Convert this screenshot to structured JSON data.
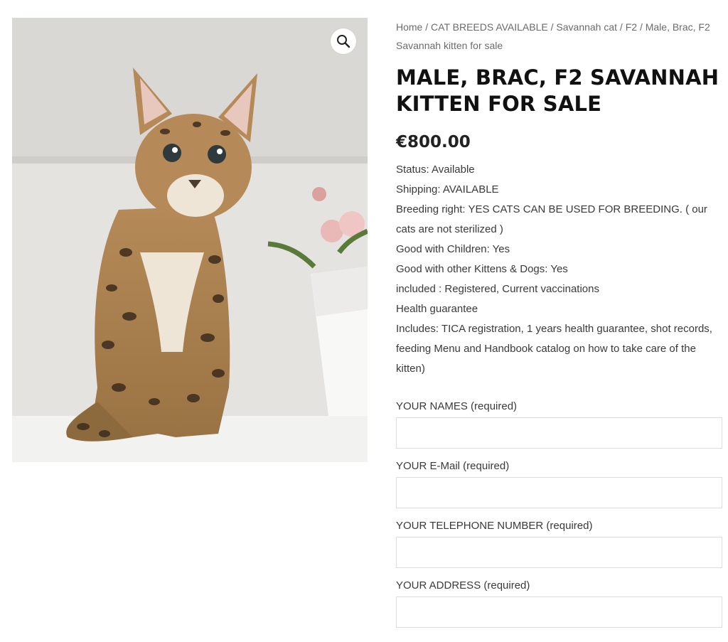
{
  "product_image": {
    "zoom_icon": "magnifier-icon"
  },
  "breadcrumb": {
    "items": [
      "Home",
      "CAT BREEDS AVAILABLE",
      "Savannah cat",
      "F2"
    ],
    "current": "Male, Brac, F2 Savannah kitten for sale",
    "separator": "/"
  },
  "product": {
    "title": "MALE, BRAC, F2 SAVANNAH KITTEN FOR SALE",
    "price": "€800.00",
    "details": [
      "Status: Available",
      "Shipping: AVAILABLE",
      "Breeding right: YES CATS CAN BE USED FOR BREEDING. ( our cats are not sterilized )",
      "Good with Children: Yes",
      "Good with other Kittens & Dogs: Yes",
      "included : Registered, Current vaccinations",
      "Health guarantee",
      "Includes: TICA registration, 1 years health guarantee, shot records, feeding Menu and Handbook catalog on how to take care of the kitten)"
    ]
  },
  "form": {
    "names_label": "YOUR NAMES (required)",
    "names_value": "",
    "email_label": "YOUR E-Mail (required)",
    "email_value": "",
    "phone_label": "YOUR TELEPHONE NUMBER (required)",
    "phone_value": "",
    "address_label": "YOUR ADDRESS (required)",
    "address_value": ""
  }
}
